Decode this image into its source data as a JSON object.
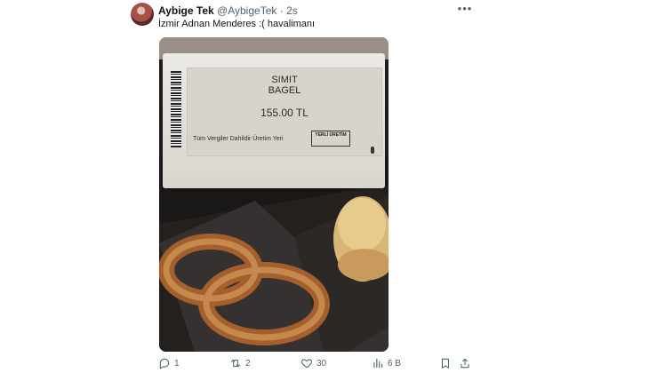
{
  "tweet": {
    "name": "Aybige Tek",
    "handle": "@AybigeTek",
    "dot": "·",
    "time": "2s",
    "text": "İzmir Adnan Menderes :( havalimanı",
    "photo": {
      "price_tag": {
        "line1": "SIMIT",
        "line2": "BAGEL",
        "price": "155.00   TL",
        "tax_line": "Tüm Vergiler Dahildir  Üretim Yeri",
        "logo": "YERLİ ÜRETİM"
      }
    },
    "actions": {
      "replies": "1",
      "retweets": "2",
      "likes": "30",
      "views": "6 B"
    }
  },
  "icons": [
    "more-icon",
    "reply-icon",
    "retweet-icon",
    "like-icon",
    "views-icon",
    "bookmark-icon",
    "share-icon"
  ]
}
